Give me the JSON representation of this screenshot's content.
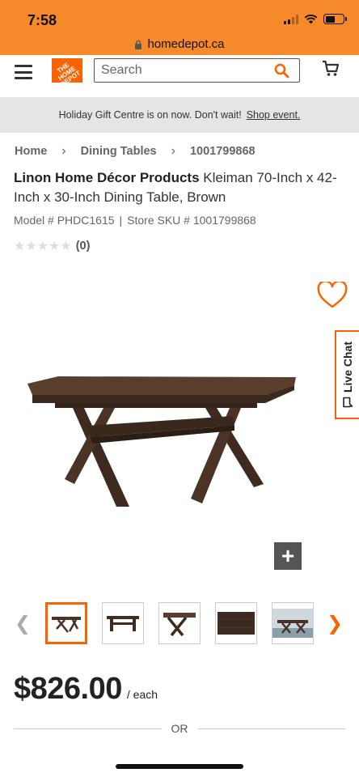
{
  "status_bar": {
    "time": "7:58",
    "url": "homedepot.ca"
  },
  "header": {
    "search_placeholder": "Search",
    "logo_text": "THE HOME DEPOT"
  },
  "banner": {
    "text": "Holiday Gift Centre is on now. Don't wait!",
    "link": "Shop event."
  },
  "breadcrumb": [
    {
      "label": "Home"
    },
    {
      "label": "Dining Tables"
    },
    {
      "label": "1001799868"
    }
  ],
  "product": {
    "brand": "Linon Home Décor Products",
    "name": "Kleiman 70-Inch x 42-Inch x 30-Inch Dining Table, Brown",
    "model": "Model # PHDC1615",
    "separator": "|",
    "sku": "Store SKU # 1001799868",
    "rating": 0,
    "rating_max": 5,
    "review_count": "(0)",
    "price": "$826.00",
    "price_unit": "/ each",
    "or_text": "OR"
  },
  "live_chat": {
    "label": "Live Chat"
  },
  "zoom_label": "+",
  "thumbnails": [
    {
      "name": "thumb-table-angle",
      "active": true
    },
    {
      "name": "thumb-table-front",
      "active": false
    },
    {
      "name": "thumb-table-top",
      "active": false
    },
    {
      "name": "thumb-table-surface",
      "active": false
    },
    {
      "name": "thumb-table-room",
      "active": false
    }
  ],
  "colors": {
    "brand_orange": "#f96302",
    "status_orange": "#f68a2a",
    "banner_gray": "#e5e5e5",
    "wood": "#4a3326"
  }
}
